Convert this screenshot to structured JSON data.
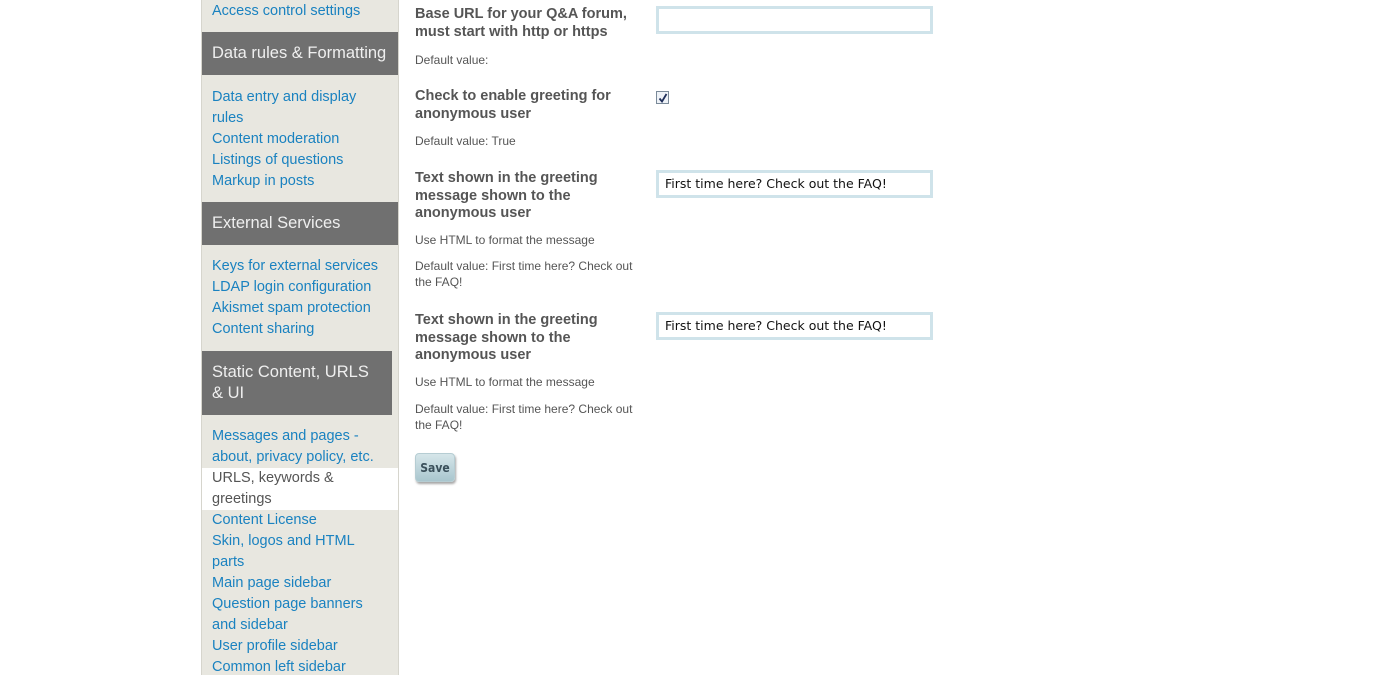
{
  "sidebar": {
    "top_link": "Access control settings",
    "groups": [
      {
        "header": "Data rules & Formatting",
        "items": [
          "Data entry and display rules",
          "Content moderation",
          "Listings of questions",
          "Markup in posts"
        ]
      },
      {
        "header": "External Services",
        "items": [
          "Keys for external services",
          "LDAP login configuration",
          "Akismet spam protection",
          "Content sharing"
        ]
      },
      {
        "header": "Static Content, URLS & UI",
        "items": [
          "Messages and pages - about, privacy policy, etc.",
          "URLS, keywords & greetings",
          "Content License",
          "Skin, logos and HTML parts",
          "Main page sidebar",
          "Question page banners and sidebar",
          "User profile sidebar",
          "Common left sidebar"
        ],
        "active_index": 1
      }
    ]
  },
  "settings": [
    {
      "label": "Base URL for your Q&A forum, must start with http or https",
      "default": "Default value:",
      "value": ""
    },
    {
      "label": "Check to enable greeting for anonymous user",
      "default": "Default value: True",
      "checked": true
    },
    {
      "label": "Text shown in the greeting message shown to the anonymous user",
      "hint": "Use HTML to format the message",
      "default": "Default value: First time here? Check out the FAQ!",
      "value": "First time here? Check out the FAQ!"
    },
    {
      "label": "Text shown in the greeting message shown to the anonymous user",
      "hint": "Use HTML to format the message",
      "default": "Default value: First time here? Check out the FAQ!",
      "value": "First time here? Check out the FAQ!"
    }
  ],
  "save_label": "Save",
  "colors": {
    "link": "#1a82c0",
    "sidebar_bg": "#e8e7e0",
    "section_header_bg": "#707070",
    "input_border": "#cfe3ea"
  }
}
